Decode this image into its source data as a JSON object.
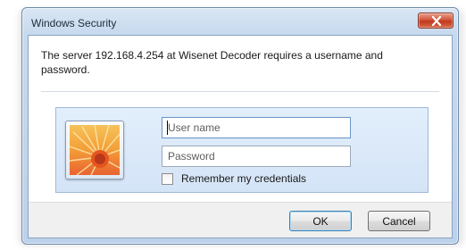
{
  "window": {
    "title": "Windows Security"
  },
  "message": "The server 192.168.4.254 at Wisenet Decoder requires a username and password.",
  "credentials": {
    "username_placeholder": "User name",
    "password_placeholder": "Password",
    "remember_label": "Remember my credentials",
    "remember_checked": false
  },
  "buttons": {
    "ok": "OK",
    "cancel": "Cancel"
  },
  "icons": {
    "close": "close-icon",
    "user_tile": "flower-user-tile-icon"
  },
  "colors": {
    "close_button": "#c0381d",
    "titlebar": "#c7d9ee",
    "panel": "#d4e4f7"
  }
}
